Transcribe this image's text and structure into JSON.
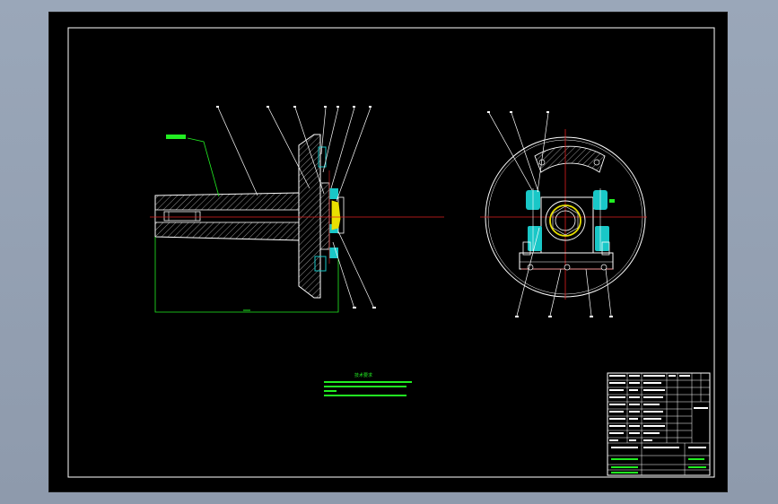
{
  "colors": {
    "background": "#94a1b3",
    "sheet": "#000000",
    "lines": "#ffffff",
    "centerline": "#e02020",
    "dimension": "#22ee22",
    "part_fill": "#19c7c7",
    "highlight": "#e8e000",
    "hatch": "#d2d2d2"
  },
  "notes": {
    "title": "技术要求"
  },
  "title_block": {
    "drawing_name": "",
    "drawing_number": ""
  }
}
